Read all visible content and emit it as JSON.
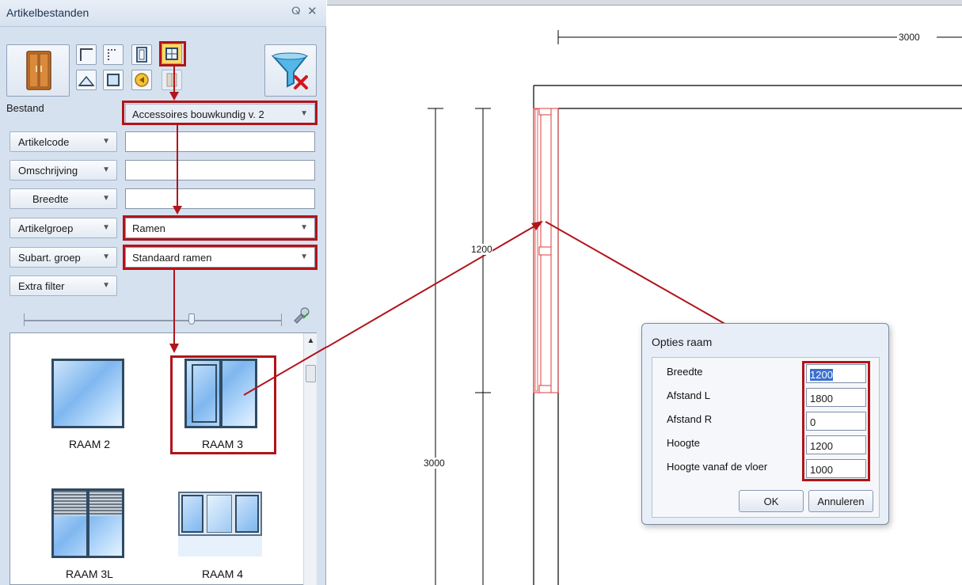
{
  "panel": {
    "title": "Artikelbestanden",
    "pin_glyph": "ⵕ",
    "close_glyph": "✕"
  },
  "filters": {
    "bestand_label": "Bestand",
    "bestand_value": "Accessoires bouwkundig v. 2",
    "artikelcode_label": "Artikelcode",
    "artikelcode_value": "",
    "omschrijving_label": "Omschrijving",
    "omschrijving_value": "",
    "breedte_label": "Breedte",
    "breedte_value": "",
    "artikelgroep_label": "Artikelgroep",
    "artikelgroep_value": "Ramen",
    "subart_label": "Subart. groep",
    "subart_value": "Standaard ramen",
    "extra_label": "Extra filter",
    "dropdown_glyph": "▼"
  },
  "gallery": {
    "items": [
      {
        "caption": "RAAM  2"
      },
      {
        "caption": "RAAM  3"
      },
      {
        "caption": "RAAM  3L"
      },
      {
        "caption": "RAAM  4"
      }
    ]
  },
  "drawing": {
    "dim_top": "3000",
    "dim_1200": "1200",
    "dim_3000_vertical": "3000"
  },
  "dialog": {
    "title": "Opties raam",
    "fields": [
      {
        "label": "Breedte",
        "value": "1200"
      },
      {
        "label": "Afstand L",
        "value": "1800"
      },
      {
        "label": "Afstand R",
        "value": "0"
      },
      {
        "label": "Hoogte",
        "value": "1200"
      },
      {
        "label": "Hoogte vanaf de vloer",
        "value": "1000"
      }
    ],
    "ok_label": "OK",
    "cancel_label": "Annuleren"
  },
  "colors": {
    "annotation_red": "#b1141a",
    "panel_bg": "#d6e1ef",
    "dialog_bg": "#e7eef8"
  },
  "icons": [
    "wardrobe-icon",
    "filter-clear-icon",
    "corner-icon",
    "grid-icon",
    "door-icon",
    "window-icon",
    "roof-icon",
    "frame-icon",
    "sound-icon",
    "cabinet-icon",
    "paint-icon"
  ]
}
